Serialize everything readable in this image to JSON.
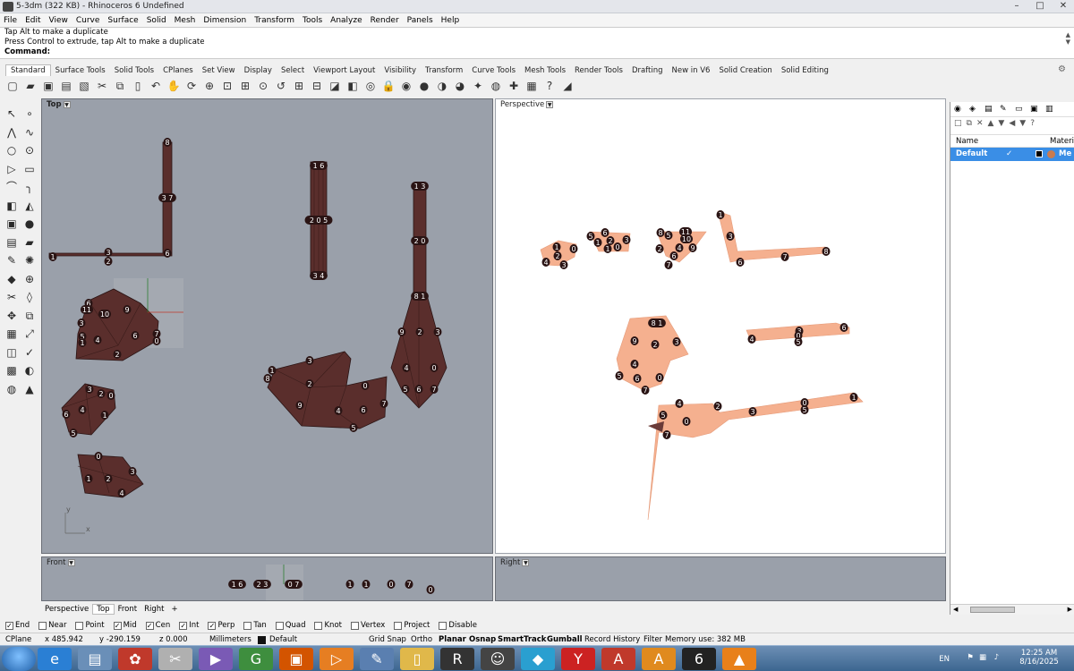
{
  "window": {
    "title": "5-3dm (322 KB) - Rhinoceros 6 Undefined",
    "min": "–",
    "max": "□",
    "close": "✕"
  },
  "menu": [
    "File",
    "Edit",
    "View",
    "Curve",
    "Surface",
    "Solid",
    "Mesh",
    "Dimension",
    "Transform",
    "Tools",
    "Analyze",
    "Render",
    "Panels",
    "Help"
  ],
  "command": {
    "line1": "Tap Alt to make a duplicate",
    "line2": "Press Control to extrude, tap Alt to make a duplicate",
    "prompt": "Command:"
  },
  "tabs": [
    "Standard",
    "Surface Tools",
    "Solid Tools",
    "CPlanes",
    "Set View",
    "Display",
    "Select",
    "Viewport Layout",
    "Visibility",
    "Transform",
    "Curve Tools",
    "Mesh Tools",
    "Render Tools",
    "Drafting",
    "New in V6",
    "Solid Creation",
    "Solid Editing"
  ],
  "toolbar_icons": [
    "new-file",
    "open",
    "save",
    "print",
    "import",
    "cut",
    "copy",
    "paste",
    "undo",
    "pan",
    "rotate",
    "zoom-in",
    "zoom-window",
    "zoom-extents",
    "zoom-selected",
    "undo-view",
    "grid",
    "cplane",
    "view",
    "layer",
    "light",
    "lock",
    "properties",
    "shaded",
    "rendered",
    "material",
    "render",
    "environment",
    "snap",
    "capture",
    "help",
    "more"
  ],
  "left_tools": [
    "select",
    "point",
    "polyline",
    "curve",
    "circle",
    "ellipse",
    "polygon",
    "rectangle",
    "arc",
    "fillet",
    "surface",
    "loft",
    "box",
    "sphere",
    "cylinder",
    "extrude",
    "edit-points",
    "explode",
    "boolean",
    "join",
    "trim",
    "split",
    "move",
    "copy",
    "array",
    "scale",
    "mirror",
    "analyze",
    "mesh",
    "check",
    "render",
    "material"
  ],
  "viewports": {
    "top": {
      "label": "Top"
    },
    "perspective": {
      "label": "Perspective"
    },
    "front": {
      "label": "Front"
    },
    "right": {
      "label": "Right"
    },
    "axis_x": "x",
    "axis_y": "y"
  },
  "viewport_tabs": [
    "Perspective",
    "Top",
    "Front",
    "Right",
    "+"
  ],
  "top_labels": [
    {
      "t": "8"
    },
    {
      "t": "3 7"
    },
    {
      "t": "1"
    },
    {
      "t": "3"
    },
    {
      "t": "2"
    },
    {
      "t": "6"
    },
    {
      "t": "1 6"
    },
    {
      "t": "2 0 5"
    },
    {
      "t": "3 4"
    },
    {
      "t": "1 3"
    },
    {
      "t": "2 0"
    },
    {
      "t": "8 1"
    },
    {
      "t": "9"
    },
    {
      "t": "2"
    },
    {
      "t": "3"
    },
    {
      "t": "4"
    },
    {
      "t": "0"
    },
    {
      "t": "5"
    },
    {
      "t": "6"
    },
    {
      "t": "7"
    },
    {
      "t": "6"
    },
    {
      "t": "11"
    },
    {
      "t": "10"
    },
    {
      "t": "9"
    },
    {
      "t": "3"
    },
    {
      "t": "5"
    },
    {
      "t": "1"
    },
    {
      "t": "4"
    },
    {
      "t": "6"
    },
    {
      "t": "7"
    },
    {
      "t": "0"
    },
    {
      "t": "2"
    },
    {
      "t": "3"
    },
    {
      "t": "1"
    },
    {
      "t": "8"
    },
    {
      "t": "2"
    },
    {
      "t": "0"
    },
    {
      "t": "9"
    },
    {
      "t": "4"
    },
    {
      "t": "6"
    },
    {
      "t": "7"
    },
    {
      "t": "5"
    },
    {
      "t": "3"
    },
    {
      "t": "2"
    },
    {
      "t": "0"
    },
    {
      "t": "6"
    },
    {
      "t": "4"
    },
    {
      "t": "1"
    },
    {
      "t": "5"
    },
    {
      "t": "0"
    },
    {
      "t": "3"
    },
    {
      "t": "1"
    },
    {
      "t": "2"
    },
    {
      "t": "4"
    }
  ],
  "persp_labels": [
    {
      "t": "1"
    },
    {
      "t": "0"
    },
    {
      "t": "2"
    },
    {
      "t": "4"
    },
    {
      "t": "3"
    },
    {
      "t": "5"
    },
    {
      "t": "6"
    },
    {
      "t": "2"
    },
    {
      "t": "1"
    },
    {
      "t": "3"
    },
    {
      "t": "0"
    },
    {
      "t": "1"
    },
    {
      "t": "8"
    },
    {
      "t": "5"
    },
    {
      "t": "11"
    },
    {
      "t": "10"
    },
    {
      "t": "2"
    },
    {
      "t": "4"
    },
    {
      "t": "9"
    },
    {
      "t": "6"
    },
    {
      "t": "7"
    },
    {
      "t": "1"
    },
    {
      "t": "3"
    },
    {
      "t": "6"
    },
    {
      "t": "7"
    },
    {
      "t": "8"
    },
    {
      "t": "8 1"
    },
    {
      "t": "9"
    },
    {
      "t": "2"
    },
    {
      "t": "3"
    },
    {
      "t": "4"
    },
    {
      "t": "5"
    },
    {
      "t": "6"
    },
    {
      "t": "0"
    },
    {
      "t": "7"
    },
    {
      "t": "3"
    },
    {
      "t": "4"
    },
    {
      "t": "0"
    },
    {
      "t": "5"
    },
    {
      "t": "6"
    },
    {
      "t": "4"
    },
    {
      "t": "5"
    },
    {
      "t": "2"
    },
    {
      "t": "3"
    },
    {
      "t": "0"
    },
    {
      "t": "7"
    },
    {
      "t": "0"
    },
    {
      "t": "1"
    },
    {
      "t": "5"
    }
  ],
  "front_labels": [
    {
      "t": "1 6"
    },
    {
      "t": "2 3"
    },
    {
      "t": "0 7"
    },
    {
      "t": "1"
    },
    {
      "t": "1"
    },
    {
      "t": "0"
    },
    {
      "t": "7"
    },
    {
      "t": "0"
    }
  ],
  "panel": {
    "col_name": "Name",
    "col_material": "Materi",
    "row_name": "Default",
    "row_mat": "Me"
  },
  "osnaps": [
    {
      "label": "End",
      "checked": true
    },
    {
      "label": "Near",
      "checked": false
    },
    {
      "label": "Point",
      "checked": false
    },
    {
      "label": "Mid",
      "checked": true
    },
    {
      "label": "Cen",
      "checked": true
    },
    {
      "label": "Int",
      "checked": true
    },
    {
      "label": "Perp",
      "checked": true
    },
    {
      "label": "Tan",
      "checked": false
    },
    {
      "label": "Quad",
      "checked": false
    },
    {
      "label": "Knot",
      "checked": false
    },
    {
      "label": "Vertex",
      "checked": false
    },
    {
      "label": "Project",
      "checked": false
    },
    {
      "label": "Disable",
      "checked": false
    }
  ],
  "status": {
    "cplane": "CPlane",
    "x": "x 485.942",
    "y": "y -290.159",
    "z": "z 0.000",
    "units": "Millimeters",
    "layer": "Default",
    "grid_snap": "Grid Snap",
    "ortho": "Ortho",
    "planar": "Planar",
    "osnap": "Osnap",
    "smarttrack": "SmartTrack",
    "gumball": "Gumball",
    "record": "Record History",
    "filter": "Filter",
    "memory": "Memory use: 382 MB"
  },
  "taskbar": {
    "lang": "EN",
    "time": "12:25 AM",
    "date": "8/16/2025"
  },
  "colors": {
    "shape_top": "#5a2e2c",
    "shape_persp": "#f5b08f",
    "viewport_gray": "#9aa0aa",
    "selection": "#3a8ee6"
  }
}
